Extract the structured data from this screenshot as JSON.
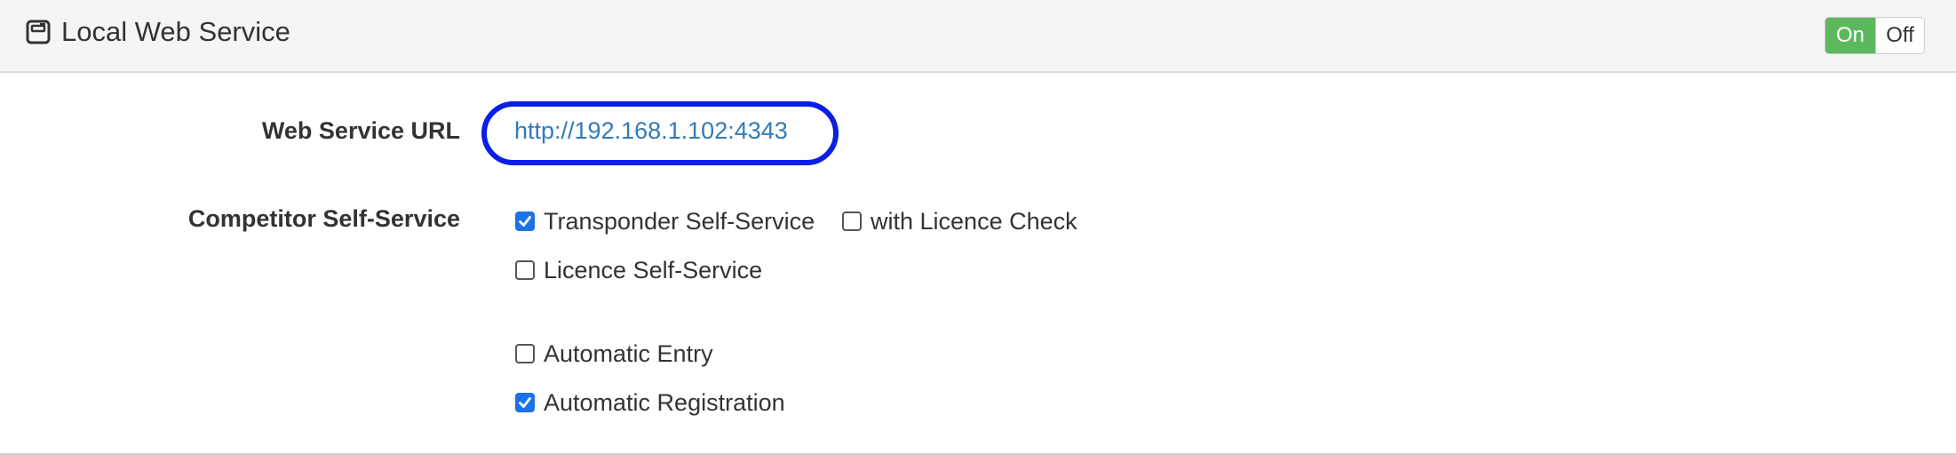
{
  "panel": {
    "title": "Local Web Service",
    "icon": "window-icon",
    "toggle": {
      "on_label": "On",
      "off_label": "Off",
      "state": "on",
      "on_color": "#5cb85c"
    }
  },
  "fields": {
    "url_label": "Web Service URL",
    "url_value": "http://192.168.1.102:4343",
    "self_service_label": "Competitor Self-Service"
  },
  "options": {
    "transponder": {
      "label": "Transponder Self-Service",
      "checked": true
    },
    "licence_check": {
      "label": "with Licence Check",
      "checked": false
    },
    "licence": {
      "label": "Licence Self-Service",
      "checked": false
    },
    "auto_entry": {
      "label": "Automatic Entry",
      "checked": false
    },
    "auto_registration": {
      "label": "Automatic Registration",
      "checked": true
    }
  },
  "colors": {
    "link": "#337ab7",
    "highlight_ring": "#0a1ee6",
    "checkbox_checked": "#1a73e8"
  }
}
